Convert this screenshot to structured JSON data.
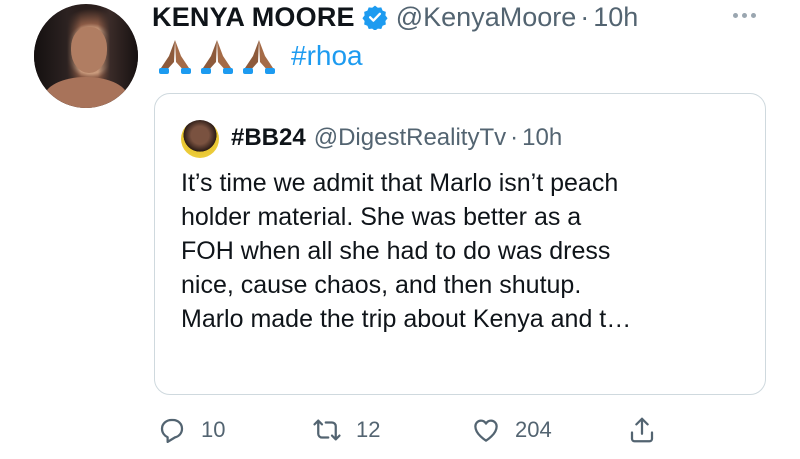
{
  "tweet": {
    "author_name": "KENYA MOORE",
    "author_handle": "@KenyaMoore",
    "separator": "·",
    "time": "10h",
    "emoji": "🙏🏾🙏🏾🙏🏾",
    "hashtag": "#rhoa"
  },
  "quoted": {
    "author_name": "#BB24",
    "author_handle": "@DigestRealityTv",
    "separator": "·",
    "time": "10h",
    "text_lines": [
      "It’s time we admit that Marlo isn’t peach",
      "holder material. She was better as a",
      "FOH when all she had to do was dress",
      "nice, cause chaos, and then shutup.",
      "Marlo made the trip about Kenya and t…"
    ]
  },
  "actions": {
    "replies": "10",
    "retweets": "12",
    "likes": "204"
  },
  "colors": {
    "accent": "#1d9bf0",
    "muted": "#536471",
    "border": "#cfd9de"
  },
  "icons": [
    "verified-badge-icon",
    "more-icon",
    "reply-icon",
    "retweet-icon",
    "like-icon",
    "share-icon"
  ]
}
